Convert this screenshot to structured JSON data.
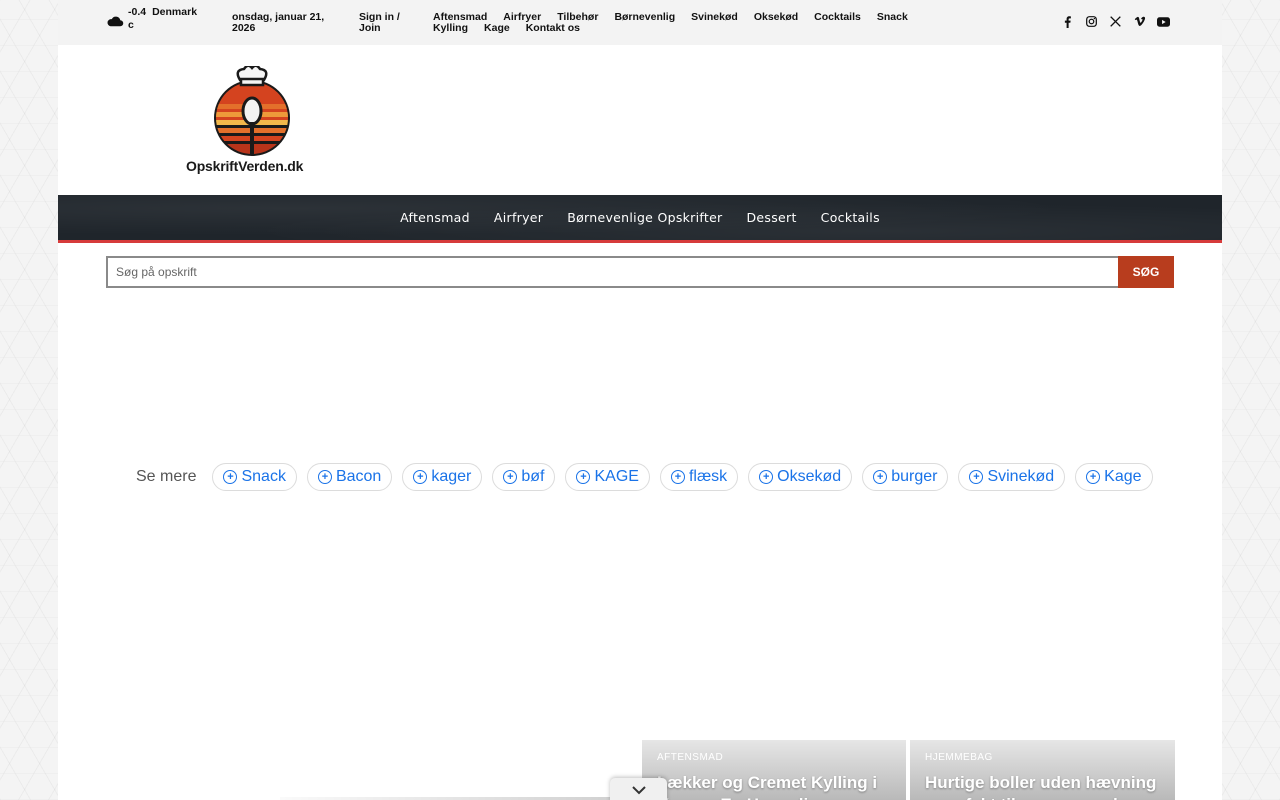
{
  "topbar": {
    "weather": {
      "temp": "-0.4",
      "unit": "c",
      "location": "Denmark"
    },
    "date": "onsdag, januar 21, 2026",
    "signin": "Sign in / Join",
    "menu": [
      "Aftensmad",
      "Airfryer",
      "Tilbehør",
      "Børnevenlig",
      "Svinekød",
      "Oksekød",
      "Cocktails",
      "Snack",
      "Kylling",
      "Kage",
      "Kontakt os"
    ],
    "social": [
      "facebook-icon",
      "instagram-icon",
      "x-icon",
      "vimeo-icon",
      "youtube-icon"
    ]
  },
  "logo": {
    "text": "OpskriftVerden.dk"
  },
  "nav": {
    "items": [
      "Aftensmad",
      "Airfryer",
      "Børnevenlige Opskrifter",
      "Dessert",
      "Cocktails"
    ]
  },
  "search": {
    "placeholder": "Søg på opskrift",
    "button": "SØG"
  },
  "tags": {
    "label": "Se mere",
    "items": [
      "Snack",
      "Bacon",
      "kager",
      "bøf",
      "KAGE",
      "flæsk",
      "Oksekød",
      "burger",
      "Svinekød",
      "Kage"
    ]
  },
  "cards": [
    {
      "category": "AFTENSMAD",
      "title": "Lækker og Cremet Kylling i Karry – En Hyggelig"
    },
    {
      "category": "HJEMMEBAG",
      "title": "Hurtige boller uden hævning – perfekt til morgenmaden"
    }
  ],
  "colors": {
    "accent": "#d63b3b",
    "search_button": "#b83d1e",
    "tag_link": "#1a73e8",
    "nav_bg": "#1f252b"
  }
}
